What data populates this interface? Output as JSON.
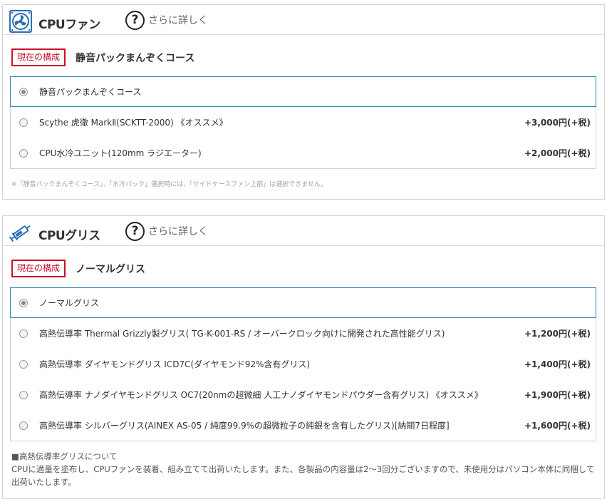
{
  "fan": {
    "title": "CPUファン",
    "more_label": "さらに詳しく",
    "more_glyph": "?",
    "current_badge": "現在の構成",
    "current_value": "静音パックまんぞくコース",
    "icon": "fan-icon",
    "options": [
      {
        "label": "静音パックまんぞくコース",
        "price": "",
        "selected": true
      },
      {
        "label": "Scythe 虎徹 MarkⅡ(SCKTT-2000) 《オススメ》",
        "price": "+3,000円(+税)",
        "selected": false
      },
      {
        "label": "CPU水冷ユニット(120mm ラジエーター)",
        "price": "+2,000円(+税)",
        "selected": false
      }
    ],
    "note": "※「静音パックまんぞくコース」、「水冷パック」選択時には、「サイドケースファン上部」は選択できません。"
  },
  "grease": {
    "title": "CPUグリス",
    "more_label": "さらに詳しく",
    "more_glyph": "?",
    "current_badge": "現在の構成",
    "current_value": "ノーマルグリス",
    "icon": "syringe-icon",
    "options": [
      {
        "label": "ノーマルグリス",
        "price": "",
        "selected": true
      },
      {
        "label": "高熱伝導率 Thermal Grizzly製グリス( TG-K-001-RS / オーバークロック向けに開発された高性能グリス)",
        "price": "+1,200円(+税)",
        "selected": false
      },
      {
        "label": "高熱伝導率 ダイヤモンドグリス ICD7C(ダイヤモンド92%含有グリス)",
        "price": "+1,400円(+税)",
        "selected": false
      },
      {
        "label": "高熱伝導率 ナノダイヤモンドグリス OC7(20nmの超微細 人工ナノダイヤモンドパウダー含有グリス) 《オススメ》",
        "price": "+1,900円(+税)",
        "selected": false
      },
      {
        "label": "高熱伝導率 シルバーグリス(AINEX AS-05 / 純度99.9%の超微粒子の純銀を含有したグリス)[納期7日程度]",
        "price": "+1,600円(+税)",
        "selected": false
      }
    ],
    "note_title": "■高熱伝導率グリスについて",
    "note_body": "CPUに適量を塗布し、CPUファンを装着、組み立てて出荷いたします。また、各製品の内容量は2～3回分ございますので、未使用分はパソコン本体に同梱して出荷いたします。"
  },
  "colors": {
    "accent_red": "#c8102e",
    "selected_border": "#2a8aa8",
    "icon_blue": "#2a6fb5"
  }
}
